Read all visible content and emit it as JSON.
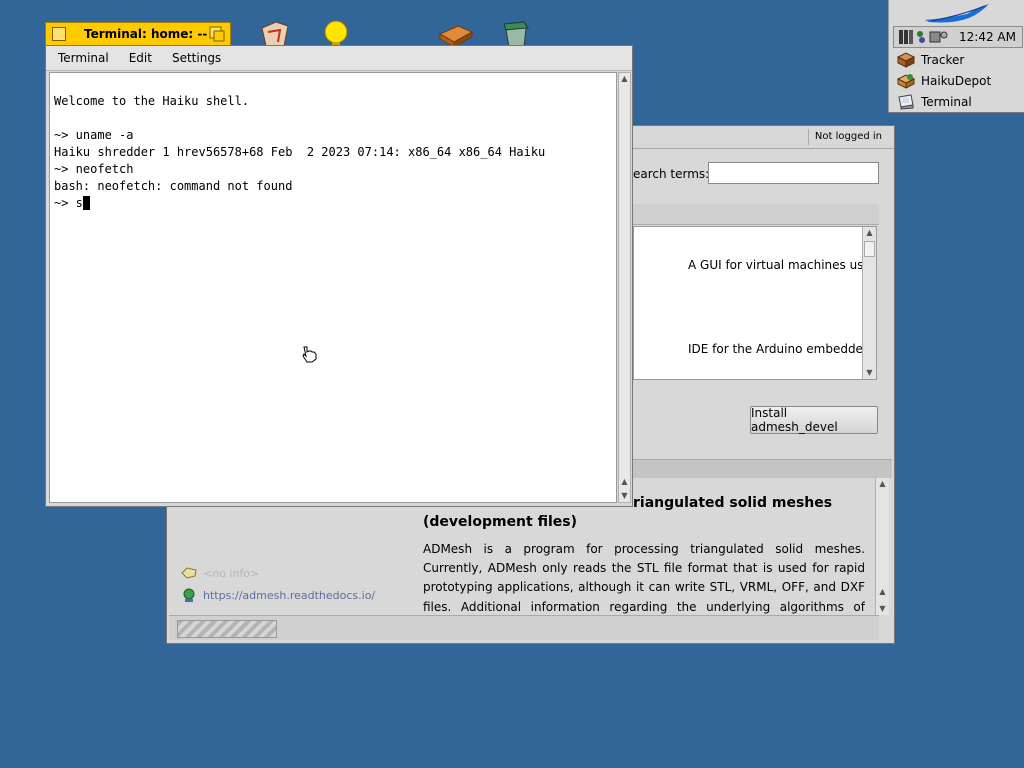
{
  "desktop": {
    "icons": [
      "documents-icon",
      "lightbulb-icon",
      "package-icon",
      "trash-icon"
    ]
  },
  "deskbar": {
    "clock": "12:42 AM",
    "apps": [
      {
        "label": "Tracker",
        "icon": "tracker-icon"
      },
      {
        "label": "HaikuDepot",
        "icon": "haikudepot-icon"
      },
      {
        "label": "Terminal",
        "icon": "terminal-icon"
      }
    ]
  },
  "terminal": {
    "title": "Terminal: home: --",
    "menu": [
      "Terminal",
      "Edit",
      "Settings"
    ],
    "lines": [
      "Welcome to the Haiku shell.",
      "",
      "~> uname -a",
      "Haiku shredder 1 hrev56578+68 Feb  2 2023 07:14: x86_64 x86_64 Haiku",
      "~> neofetch",
      "bash: neofetch: command not found",
      "~> s"
    ]
  },
  "depot": {
    "login_status": "Not logged in",
    "search_label": "earch terms:",
    "search_value": "",
    "list_rows": [
      "A GUI for virtual machines us...",
      "IDE for the Arduino embedde..."
    ],
    "install_button": "Install admesh_devel",
    "package_title_line1": "riangulated solid meshes",
    "package_title_line2": "(development files)",
    "description": "ADMesh is a program for processing triangulated solid meshes. Currently, ADMesh only reads the STL file format that is used for rapid prototyping applications, although it can write STL, VRML, OFF, and DXF files. Additional information regarding the underlying algorithms of ADMesh can be found in Anthony Martins",
    "no_info": "<no info>",
    "homepage": "https://admesh.readthedocs.io/"
  }
}
